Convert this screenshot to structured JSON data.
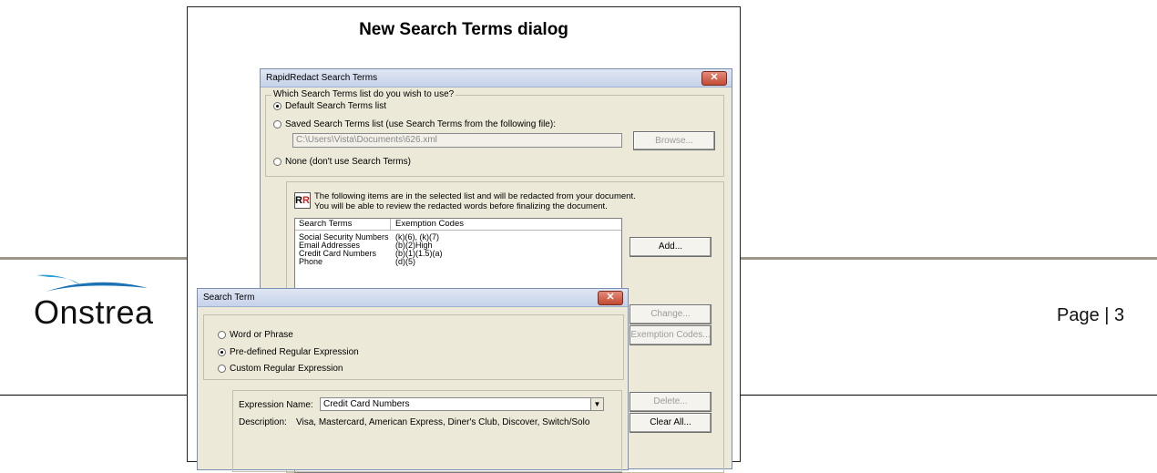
{
  "figure": {
    "title": "New Search Terms dialog"
  },
  "page": {
    "logo_text": "Onstrea",
    "page_number": "Page | 3"
  },
  "main_dialog": {
    "title": "RapidRedact Search Terms",
    "question": "Which Search Terms list do you wish to use?",
    "options": [
      "Default Search Terms list",
      "Saved Search Terms list (use Search Terms from the following file):",
      "None (don't use Search Terms)"
    ],
    "selected_option": 0,
    "file_path": "C:\\Users\\Vista\\Documents\\626.xml",
    "browse_label": "Browse...",
    "info_line1": "The following items are in the selected list and will be redacted from your document.",
    "info_line2": "You will be able to review the redacted words before finalizing the document.",
    "columns": [
      "Search Terms",
      "Exemption Codes"
    ],
    "rows": [
      [
        "Social Security Numbers",
        "(k)(6), (k)(7)"
      ],
      [
        "Email Addresses",
        "(b)(2)High"
      ],
      [
        "Credit Card Numbers",
        "(b)(1)(1.5)(a)"
      ],
      [
        "Phone",
        "(d)(5)"
      ]
    ],
    "buttons": {
      "add": "Add...",
      "change": "Change...",
      "exemption_codes": "Exemption Codes...",
      "delete": "Delete...",
      "clear_all": "Clear All..."
    }
  },
  "term_dialog": {
    "title": "Search Term",
    "options": [
      "Word or Phrase",
      "Pre-defined Regular Expression",
      "Custom Regular Expression"
    ],
    "selected_option": 1,
    "expression_label": "Expression Name:",
    "expression_value": "Credit Card Numbers",
    "description_label": "Description:",
    "description_value": "Visa, Mastercard, American Express, Diner's Club, Discover, Switch/Solo"
  }
}
